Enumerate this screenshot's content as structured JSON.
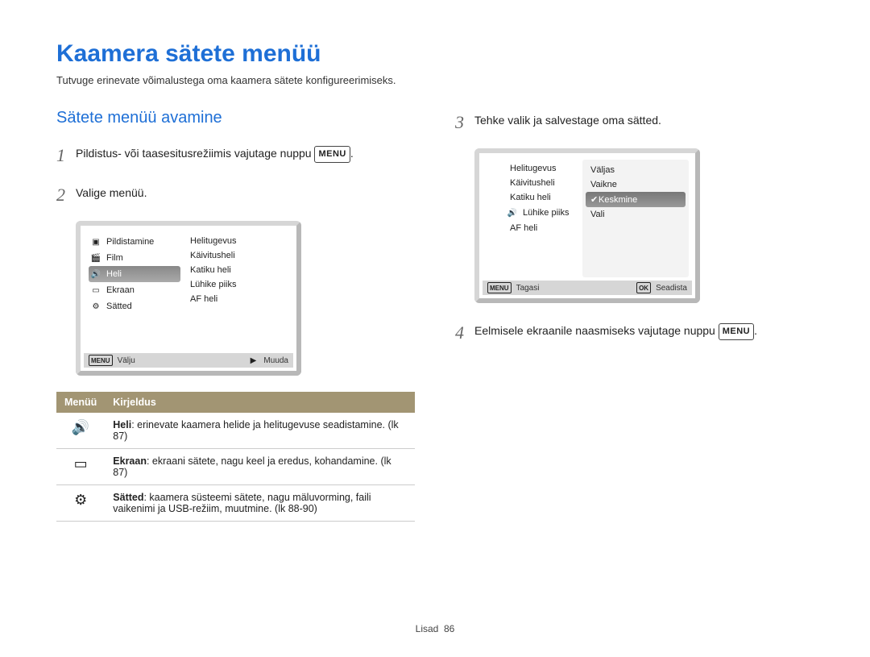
{
  "title": "Kaamera sätete menüü",
  "subtitle": "Tutvuge erinevate võimalustega oma kaamera sätete konfigureerimiseks.",
  "section": "Sätete menüü avamine",
  "steps": {
    "s1_pre": "Pildistus- või taasesitusrežiimis vajutage nuppu ",
    "menu_label": "MENU",
    "s1_post": ".",
    "s2": "Valige menüü.",
    "s3": "Tehke valik ja salvestage oma sätted.",
    "s4_pre": "Eelmisele ekraanile naasmiseks vajutage nuppu ",
    "s4_post": "."
  },
  "nums": {
    "n1": "1",
    "n2": "2",
    "n3": "3",
    "n4": "4"
  },
  "lcd1": {
    "left": [
      "Pildistamine",
      "Film",
      "Heli",
      "Ekraan",
      "Sätted"
    ],
    "right": [
      "Helitugevus",
      "Käivitusheli",
      "Katiku heli",
      "Lühike piiks",
      "AF heli"
    ],
    "foot_left_icon": "MENU",
    "foot_left": "Välju",
    "foot_right_icon": "▶",
    "foot_right": "Muuda"
  },
  "lcd2": {
    "left": [
      "Helitugevus",
      "Käivitusheli",
      "Katiku heli",
      "Lühike piiks",
      "AF heli"
    ],
    "right": [
      "Väljas",
      "Vaikne",
      "Keskmine",
      "Vali"
    ],
    "foot_left_icon": "MENU",
    "foot_left": "Tagasi",
    "foot_right_icon": "OK",
    "foot_right": "Seadista"
  },
  "table": {
    "h1": "Menüü",
    "h2": "Kirjeldus",
    "rows": [
      {
        "icon": "sound-icon",
        "desc_b": "Heli",
        "desc": ": erinevate kaamera helide ja helitugevuse seadistamine. (lk 87)"
      },
      {
        "icon": "screen-icon",
        "desc_b": "Ekraan",
        "desc": ": ekraani sätete, nagu keel ja eredus, kohandamine. (lk 87)"
      },
      {
        "icon": "gear-icon",
        "desc_b": "Sätted",
        "desc": ": kaamera süsteemi sätete, nagu mäluvorming, faili vaikenimi ja USB-režiim, muutmine. (lk 88-90)"
      }
    ]
  },
  "footer_label": "Lisad",
  "footer_page": "86"
}
